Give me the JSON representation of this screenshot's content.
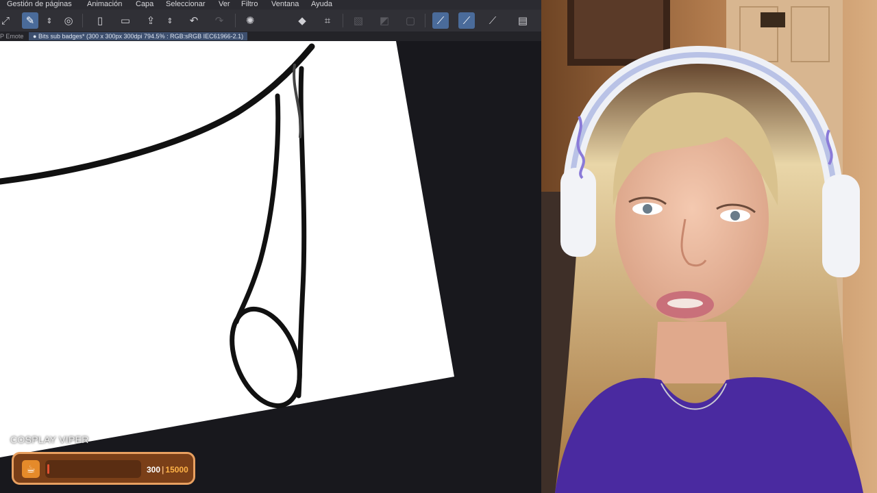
{
  "app": {
    "menu": [
      "Gestión de páginas",
      "Animación",
      "Capa",
      "Seleccionar",
      "Ver",
      "Filtro",
      "Ventana",
      "Ayuda"
    ],
    "tabs": {
      "previous_label": "P Emote",
      "active_label": "Bits sub badges* (300 x 300px 300dpi 794.5% : RGB:sRGB IEC61966-2.1)"
    },
    "toolbar_icons": [
      "pen-tool-icon",
      "brush-settings-icon",
      "spinner-arrows-icon",
      "navigator-icon",
      "new-file-icon",
      "open-folder-icon",
      "export-icon",
      "spinner-arrows-icon",
      "undo-icon",
      "redo-icon",
      "loading-icon",
      "fill-icon",
      "crop-icon",
      "selection-clear-icon",
      "selection-invert-icon",
      "selection-icon",
      "stabilizer-icon",
      "brush-icon",
      "ruler-icon",
      "tablet-icon"
    ]
  },
  "overlay": {
    "goal_title": "COSPLAY VIPER",
    "goal_current": "300",
    "goal_separator": "|",
    "goal_target": "15000",
    "goal_progress": 0.02,
    "colors": {
      "bar_bg": "#7a3f18",
      "bar_border": "#e8a060",
      "target_text": "#ffb347",
      "fill": "#e25030"
    }
  },
  "colors": {
    "app_bg": "#18181d",
    "toolbar_bg": "#303036",
    "active_tool": "#4a6b9a",
    "canvas_paper": "#ffffff"
  }
}
